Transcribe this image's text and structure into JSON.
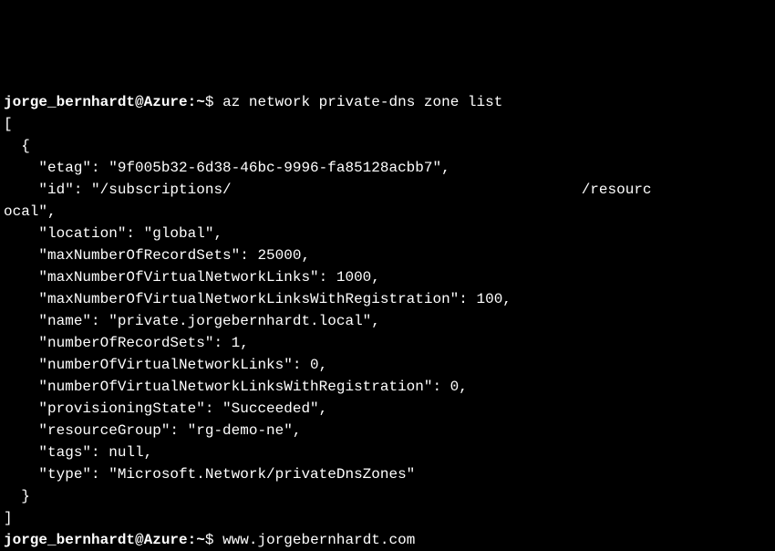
{
  "prompt1": {
    "user": "jorge_bernhardt@Azure",
    "sep": ":",
    "path": "~",
    "end": "$ ",
    "command": "az network private-dns zone list"
  },
  "output": {
    "line01": "[",
    "line02": "  {",
    "line03": "    \"etag\": \"9f005b32-6d38-46bc-9996-fa85128acbb7\",",
    "line04": "    \"id\": \"/subscriptions/                                        /resourc",
    "line05": "ocal\",",
    "line06": "    \"location\": \"global\",",
    "line07": "    \"maxNumberOfRecordSets\": 25000,",
    "line08": "    \"maxNumberOfVirtualNetworkLinks\": 1000,",
    "line09": "    \"maxNumberOfVirtualNetworkLinksWithRegistration\": 100,",
    "line10": "    \"name\": \"private.jorgebernhardt.local\",",
    "line11": "    \"numberOfRecordSets\": 1,",
    "line12": "    \"numberOfVirtualNetworkLinks\": 0,",
    "line13": "    \"numberOfVirtualNetworkLinksWithRegistration\": 0,",
    "line14": "    \"provisioningState\": \"Succeeded\",",
    "line15": "    \"resourceGroup\": \"rg-demo-ne\",",
    "line16": "    \"tags\": null,",
    "line17": "    \"type\": \"Microsoft.Network/privateDnsZones\"",
    "line18": "  }",
    "line19": "]"
  },
  "prompt2": {
    "user": "jorge_bernhardt@Azure",
    "sep": ":",
    "path": "~",
    "end": "$ ",
    "command": "www.jorgebernhardt.com"
  }
}
